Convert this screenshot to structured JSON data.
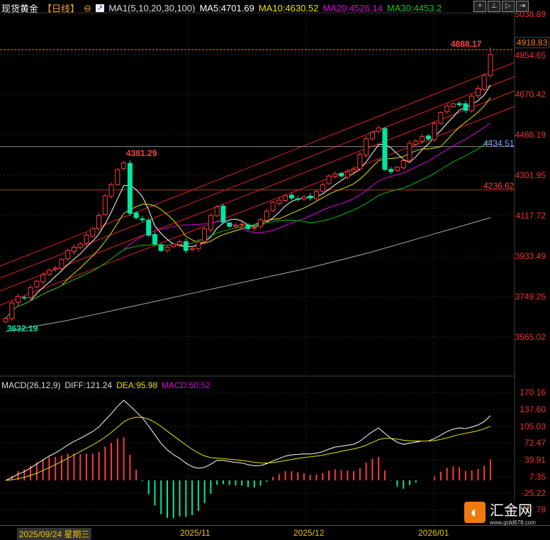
{
  "header": {
    "symbol": "现货黄金",
    "period": "【日线】",
    "indicator": "MA1(5,10,20,30,100)",
    "ma5": "MA5:4701.69",
    "ma10": "MA10:4630.52",
    "ma20": "MA20:4526.14",
    "ma30": "MA30:4453.2"
  },
  "toolbar": [
    "+",
    "⊥",
    "▷",
    "⇥"
  ],
  "colors": {
    "up": "#ff3a3a",
    "down": "#00e6a0",
    "ma5": "#ffffff",
    "ma10": "#e6e600",
    "ma20": "#e000e0",
    "ma30": "#00c000",
    "ma100": "#aaaaaa"
  },
  "price_axis": [
    "5038.89",
    "4854.65",
    "4670.42",
    "4486.19",
    "4301.95",
    "4117.72",
    "3933.49",
    "3749.25",
    "3565.02"
  ],
  "annotations": {
    "high": "4888.17",
    "last_price": "4918.83",
    "peak": "4381.29",
    "low": "3632.19",
    "support": "4434.51",
    "resistance": "4236.62"
  },
  "macd": {
    "label": "MACD(26,12,9)",
    "diff": "DIFF:121.24",
    "dea": "DEA:95.98",
    "macd": "MACD:50.52",
    "axis": [
      "170.16",
      "137.60",
      "105.03",
      "72.47",
      "39.91",
      "7.35",
      "-25.22",
      "-57.78"
    ]
  },
  "xaxis": {
    "current": "2025/09/24 星期三",
    "labels": [
      "2025/11",
      "2025/12",
      "2026/01"
    ]
  },
  "logo": {
    "name": "汇金网",
    "url": "www.gold678.com"
  },
  "chart_data": {
    "type": "candlestick",
    "closes": [
      3650,
      3720,
      3750,
      3745,
      3790,
      3820,
      3850,
      3870,
      3880,
      3920,
      3960,
      3975,
      3990,
      4030,
      4060,
      4120,
      4210,
      4260,
      4330,
      4360,
      4130,
      4110,
      4100,
      4030,
      3990,
      3960,
      3975,
      3990,
      4000,
      3960,
      3970,
      4000,
      4060,
      4120,
      4160,
      4090,
      4070,
      4075,
      4080,
      4060,
      4065,
      4100,
      4140,
      4180,
      4190,
      4210,
      4200,
      4195,
      4205,
      4200,
      4230,
      4260,
      4300,
      4310,
      4300,
      4320,
      4330,
      4400,
      4470,
      4500,
      4520,
      4330,
      4320,
      4340,
      4370,
      4450,
      4460,
      4480,
      4470,
      4540,
      4590,
      4620,
      4630,
      4625,
      4600,
      4665,
      4700,
      4760,
      4855
    ],
    "last_high": 4888.17,
    "ma100": [
      3590,
      3640,
      3700,
      3760,
      3820,
      3880,
      3950,
      4030,
      4110
    ],
    "ylim": [
      3565.02,
      5038.89
    ]
  }
}
